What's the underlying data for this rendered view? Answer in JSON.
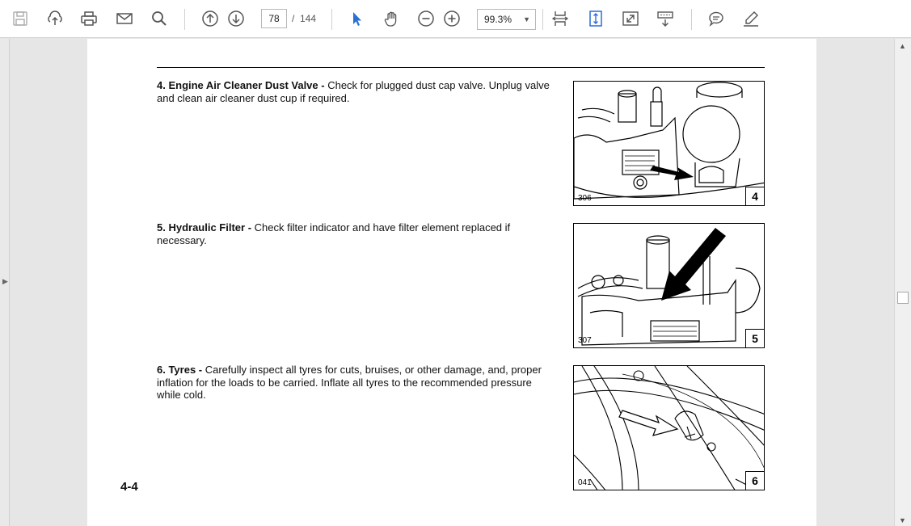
{
  "toolbar": {
    "icons": [
      "save-icon",
      "upload-icon",
      "print-icon",
      "email-icon",
      "search-icon",
      "page-up-icon",
      "page-down-icon",
      "select-cursor-icon",
      "hand-tool-icon",
      "zoom-out-icon",
      "zoom-in-icon",
      "fit-width-icon",
      "fit-page-icon",
      "fullscreen-icon",
      "scroll-mode-icon",
      "comment-icon",
      "sign-icon"
    ],
    "current_page": "78",
    "page_separator": "/",
    "total_pages": "144",
    "zoom": "99.3%"
  },
  "document": {
    "items": [
      {
        "title": "4. Engine Air Cleaner Dust Valve -",
        "body": " Check for plugged dust cap valve. Unplug valve and clean air cleaner dust cup if required.",
        "figure_code": "306",
        "figure_number": "4"
      },
      {
        "title": "5. Hydraulic Filter -",
        "body": " Check filter indicator and have filter element replaced if necessary.",
        "figure_code": "307",
        "figure_number": "5"
      },
      {
        "title": "6. Tyres -",
        "body": " Carefully inspect all tyres for cuts, bruises, or other damage, and, proper inflation for the loads to be carried. Inflate all tyres to the recommended pressure while cold.",
        "figure_code": "041",
        "figure_number": "6"
      }
    ],
    "page_label": "4-4"
  }
}
